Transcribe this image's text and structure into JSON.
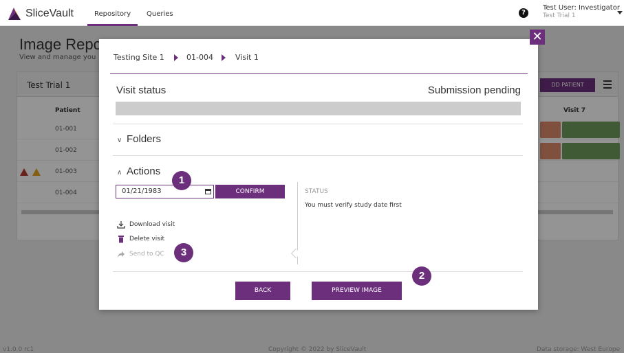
{
  "app": {
    "logo_text": "SliceVault",
    "tabs": [
      "Repository",
      "Queries"
    ],
    "help_icon": "question-circle-icon",
    "user": {
      "name": "Test User: Investigator",
      "trial": "Test Trial 1"
    }
  },
  "background": {
    "title": "Image Repo",
    "subtitle": "View and manage you",
    "panel_title": "Test Trial 1",
    "add_button": "DD PATIENT",
    "columns": {
      "patient": "Patient",
      "visit7": "Visit 7"
    },
    "rows": [
      "01-001",
      "01-002",
      "01-003",
      "01-004"
    ],
    "footer": {
      "version": "v1.0.0 rc1",
      "copyright": "Copyright © 2022 by SliceVault",
      "storage": "Data storage: West Europe"
    },
    "colors": {
      "cell_orange": "#d98a6a",
      "cell_green": "#6e9b5c",
      "warn_red": "#b03a2e",
      "warn_amber": "#e0a020"
    }
  },
  "modal": {
    "breadcrumb": [
      "Testing Site 1",
      "01-004",
      "Visit 1"
    ],
    "visit_status_label": "Visit status",
    "visit_status_value": "Submission pending",
    "folders_label": "Folders",
    "actions_label": "Actions",
    "date_value": "01/21/1983",
    "confirm_label": "CONFIRM",
    "status_label": "STATUS",
    "status_message": "You must verify study date first",
    "actions": {
      "download": "Download visit",
      "delete": "Delete visit",
      "send_qc": "Send to QC"
    },
    "back_label": "BACK",
    "preview_label": "PREVIEW IMAGE",
    "close_glyph": "✕",
    "badges": [
      "1",
      "2",
      "3"
    ],
    "accent_color": "#6b2f7c"
  }
}
